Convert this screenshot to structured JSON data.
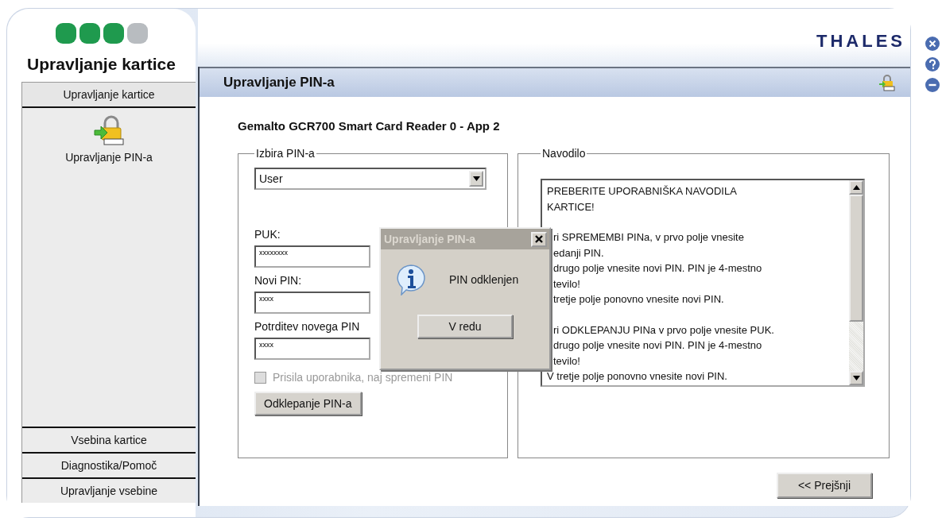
{
  "app_title": "Upravljanje kartice",
  "brand": "THALES",
  "nav": [
    {
      "label": "Upravljanje kartice",
      "expanded": true,
      "items": [
        {
          "label": "Upravljanje PIN-a"
        }
      ]
    },
    {
      "label": "Vsebina kartice",
      "expanded": false
    },
    {
      "label": "Diagnostika/Pomoč",
      "expanded": false
    },
    {
      "label": "Upravljanje vsebine",
      "expanded": false
    }
  ],
  "panel": {
    "title": "Upravljanje PIN-a",
    "device": "Gemalto GCR700 Smart Card Reader 0 - App 2",
    "pin_group": {
      "legend": "Izbira PIN-a",
      "pin_type": "User",
      "fields": [
        {
          "label": "PUK:",
          "value": "xxxxxxxx"
        },
        {
          "label": "Novi PIN:",
          "value": "xxxx"
        },
        {
          "label": "Potrditev novega PIN",
          "value": "xxxx"
        }
      ],
      "force_change": {
        "label": "Prisila uporabnika, naj spremeni PIN",
        "checked": false,
        "disabled": true
      },
      "unlock_button": "Odklepanje PIN-a"
    },
    "help_group": {
      "legend": "Navodilo",
      "paragraphs": [
        {
          "lines": [
            {
              "text": "PREBERITE UPORABNIŠKA NAVODILA",
              "covered": false
            },
            {
              "text": "KARTICE!",
              "covered": false
            }
          ]
        },
        {
          "lines": [
            {
              "text": "ri SPREMEMBI PINa, v prvo polje vnesite",
              "covered": true
            },
            {
              "text": "edanji PIN.",
              "covered": true
            },
            {
              "text": "drugo polje vnesite novi PIN. PIN je 4-mestno",
              "covered": true
            },
            {
              "text": "tevilo!",
              "covered": true
            },
            {
              "text": "tretje polje ponovno vnesite novi PIN.",
              "covered": true
            }
          ]
        },
        {
          "lines": [
            {
              "text": "ri ODKLEPANJU PINa v prvo polje vnesite PUK.",
              "covered": true
            },
            {
              "text": "drugo polje vnesite novi PIN. PIN je 4-mestno",
              "covered": true
            },
            {
              "text": "tevilo!",
              "covered": true
            },
            {
              "text": "V tretje polje ponovno vnesite novi PIN.",
              "covered": false
            }
          ]
        }
      ]
    },
    "back_button": "<< Prejšnji"
  },
  "dialog": {
    "title": "Upravljanje PIN-a",
    "message": "PIN odklenjen",
    "ok_button": "V redu"
  }
}
